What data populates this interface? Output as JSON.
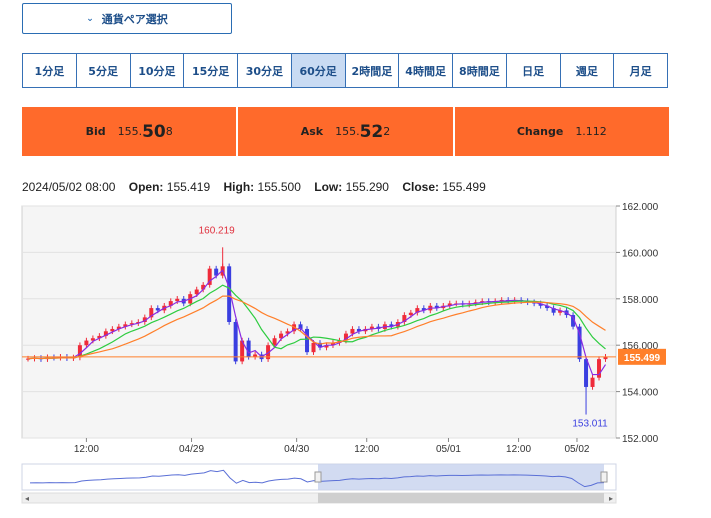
{
  "pair_select": {
    "label": "通貨ペア選択"
  },
  "timeframes": [
    "1分足",
    "5分足",
    "10分足",
    "15分足",
    "30分足",
    "60分足",
    "2時間足",
    "4時間足",
    "8時間足",
    "日足",
    "週足",
    "月足"
  ],
  "active_timeframe": "60分足",
  "quote": {
    "bid_label": "Bid",
    "bid_prefix": "155.",
    "bid_big": "50",
    "bid_small": "8",
    "ask_label": "Ask",
    "ask_prefix": "155.",
    "ask_big": "52",
    "ask_small": "2",
    "change_label": "Change",
    "change_value": "1.112"
  },
  "ohlc": {
    "datetime": "2024/05/02 08:00",
    "open_label": "Open:",
    "open": "155.419",
    "high_label": "High:",
    "high": "155.500",
    "low_label": "Low:",
    "low": "155.290",
    "close_label": "Close:",
    "close": "155.499"
  },
  "chart_data": {
    "type": "candlestick",
    "ylim": [
      152.0,
      162.0
    ],
    "y_ticks": [
      "162.000",
      "160.000",
      "158.000",
      "156.000",
      "154.000",
      "152.000"
    ],
    "x_ticks": [
      "12:00",
      "04/29",
      "04/30",
      "12:00",
      "05/01",
      "12:00",
      "05/02"
    ],
    "last_price_label": "155.499",
    "last_price": 155.499,
    "annotations": {
      "high_label": "160.219",
      "high": 160.219,
      "low_label": "153.011",
      "low": 153.011
    },
    "colors": {
      "up": "#ef2b3a",
      "down": "#3a3fe0",
      "ma_short": "#8a2be2",
      "ma_mid": "#2ecc40",
      "ma_long": "#ff7f2a",
      "last_line": "#ff7f2a",
      "navigator": "#5a6fd6"
    },
    "closes": [
      155.42,
      155.45,
      155.4,
      155.48,
      155.46,
      155.5,
      155.44,
      155.47,
      156.0,
      156.2,
      156.3,
      156.4,
      156.6,
      156.7,
      156.8,
      156.9,
      156.95,
      157.0,
      157.2,
      157.6,
      157.5,
      157.7,
      157.9,
      158.0,
      157.8,
      158.2,
      158.4,
      158.6,
      159.3,
      159.0,
      159.4,
      157.0,
      155.3,
      156.2,
      155.5,
      155.6,
      155.4,
      156.0,
      156.3,
      156.5,
      156.6,
      156.9,
      156.7,
      155.7,
      156.1,
      155.9,
      156.0,
      156.1,
      156.2,
      156.5,
      156.7,
      156.6,
      156.7,
      156.8,
      156.7,
      156.9,
      156.8,
      157.0,
      157.3,
      157.4,
      157.6,
      157.5,
      157.7,
      157.6,
      157.7,
      157.8,
      157.8,
      157.75,
      157.8,
      157.85,
      157.9,
      157.85,
      157.9,
      157.95,
      157.9,
      157.95,
      157.9,
      157.85,
      157.8,
      157.7,
      157.6,
      157.4,
      157.5,
      157.3,
      156.8,
      155.4,
      154.2,
      154.6,
      155.4,
      155.5
    ]
  }
}
